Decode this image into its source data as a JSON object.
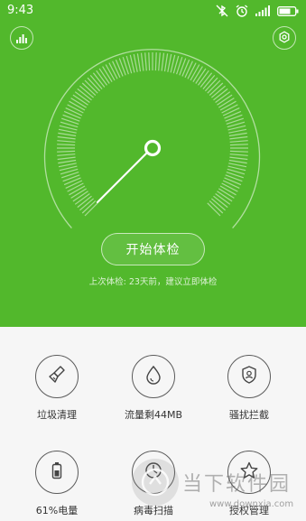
{
  "status_bar": {
    "time": "9:43",
    "icons": [
      "bluetooth-muted-icon",
      "alarm-icon",
      "signal-icon",
      "battery-icon"
    ]
  },
  "header": {
    "left_icon": "stats-icon",
    "right_icon": "settings-icon"
  },
  "gauge": {
    "level": 0
  },
  "main": {
    "start_button": "开始体检",
    "last_check": "上次体检: 23天前，建议立即体检"
  },
  "tools": [
    {
      "label": "垃圾清理",
      "icon": "broom-icon"
    },
    {
      "label": "流量剩44MB",
      "icon": "droplet-icon"
    },
    {
      "label": "骚扰拦截",
      "icon": "shield-user-icon"
    },
    {
      "label": "61%电量",
      "icon": "battery-level-icon"
    },
    {
      "label": "病毒扫描",
      "icon": "virus-scan-icon"
    },
    {
      "label": "授权管理",
      "icon": "star-icon"
    }
  ],
  "watermark": {
    "name": "当下软件园",
    "url": "www.downxia.com"
  },
  "colors": {
    "primary_green": "#52b82c",
    "background": "#f6f6f6",
    "text_dark": "#333333"
  }
}
